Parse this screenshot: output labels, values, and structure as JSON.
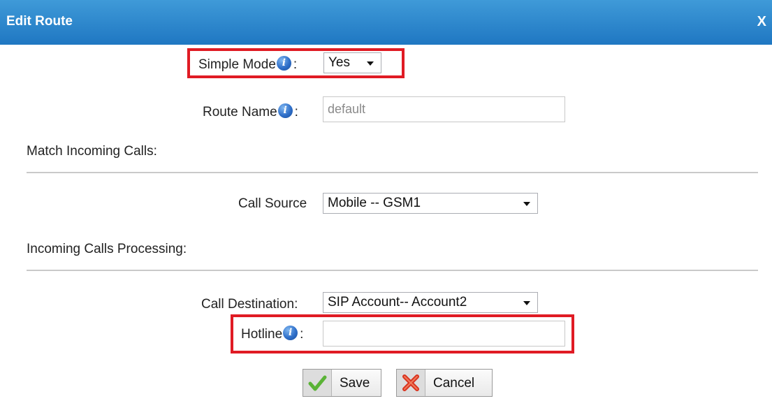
{
  "dialog": {
    "title": "Edit Route",
    "close_label": "X"
  },
  "form": {
    "simple_mode": {
      "label": "Simple Mode",
      "colon": ":",
      "value": "Yes",
      "info_glyph": "i"
    },
    "route_name": {
      "label": "Route Name",
      "colon": ":",
      "value": "default",
      "info_glyph": "i"
    },
    "match_section": "Match Incoming Calls:",
    "call_source": {
      "label": "Call Source",
      "value": "Mobile -- GSM1"
    },
    "processing_section": "Incoming Calls Processing:",
    "call_destination": {
      "label": "Call Destination:",
      "value": "SIP Account-- Account2"
    },
    "hotline": {
      "label": "Hotline",
      "colon": ":",
      "value": "",
      "info_glyph": "i"
    }
  },
  "buttons": {
    "save": {
      "label": "Save",
      "icon": "check-icon"
    },
    "cancel": {
      "label": "Cancel",
      "icon": "x-mark-icon"
    }
  },
  "colors": {
    "title_bar": "#2f8ad0",
    "highlight_border": "#e01b24",
    "info_icon": "#2f6fc9",
    "check_icon": "#5ab336",
    "cancel_icon": "#d9331f"
  }
}
